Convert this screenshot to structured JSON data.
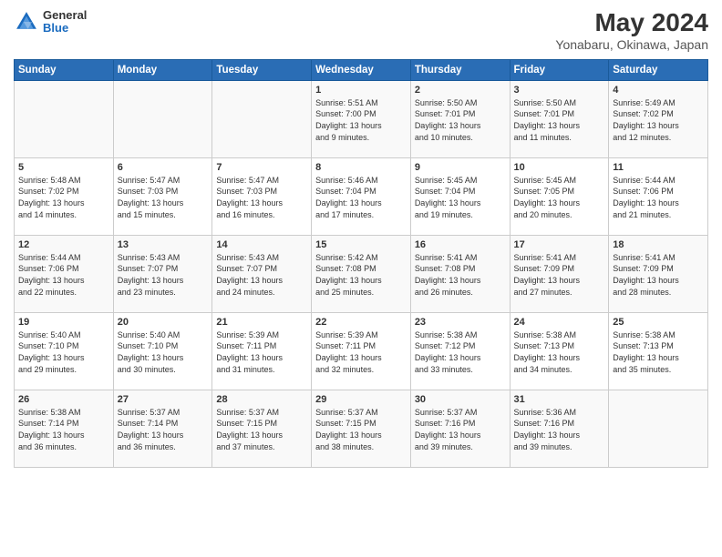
{
  "header": {
    "logo_general": "General",
    "logo_blue": "Blue",
    "title": "May 2024",
    "subtitle": "Yonabaru, Okinawa, Japan"
  },
  "days_of_week": [
    "Sunday",
    "Monday",
    "Tuesday",
    "Wednesday",
    "Thursday",
    "Friday",
    "Saturday"
  ],
  "weeks": [
    [
      {
        "day": "",
        "info": ""
      },
      {
        "day": "",
        "info": ""
      },
      {
        "day": "",
        "info": ""
      },
      {
        "day": "1",
        "info": "Sunrise: 5:51 AM\nSunset: 7:00 PM\nDaylight: 13 hours\nand 9 minutes."
      },
      {
        "day": "2",
        "info": "Sunrise: 5:50 AM\nSunset: 7:01 PM\nDaylight: 13 hours\nand 10 minutes."
      },
      {
        "day": "3",
        "info": "Sunrise: 5:50 AM\nSunset: 7:01 PM\nDaylight: 13 hours\nand 11 minutes."
      },
      {
        "day": "4",
        "info": "Sunrise: 5:49 AM\nSunset: 7:02 PM\nDaylight: 13 hours\nand 12 minutes."
      }
    ],
    [
      {
        "day": "5",
        "info": "Sunrise: 5:48 AM\nSunset: 7:02 PM\nDaylight: 13 hours\nand 14 minutes."
      },
      {
        "day": "6",
        "info": "Sunrise: 5:47 AM\nSunset: 7:03 PM\nDaylight: 13 hours\nand 15 minutes."
      },
      {
        "day": "7",
        "info": "Sunrise: 5:47 AM\nSunset: 7:03 PM\nDaylight: 13 hours\nand 16 minutes."
      },
      {
        "day": "8",
        "info": "Sunrise: 5:46 AM\nSunset: 7:04 PM\nDaylight: 13 hours\nand 17 minutes."
      },
      {
        "day": "9",
        "info": "Sunrise: 5:45 AM\nSunset: 7:04 PM\nDaylight: 13 hours\nand 19 minutes."
      },
      {
        "day": "10",
        "info": "Sunrise: 5:45 AM\nSunset: 7:05 PM\nDaylight: 13 hours\nand 20 minutes."
      },
      {
        "day": "11",
        "info": "Sunrise: 5:44 AM\nSunset: 7:06 PM\nDaylight: 13 hours\nand 21 minutes."
      }
    ],
    [
      {
        "day": "12",
        "info": "Sunrise: 5:44 AM\nSunset: 7:06 PM\nDaylight: 13 hours\nand 22 minutes."
      },
      {
        "day": "13",
        "info": "Sunrise: 5:43 AM\nSunset: 7:07 PM\nDaylight: 13 hours\nand 23 minutes."
      },
      {
        "day": "14",
        "info": "Sunrise: 5:43 AM\nSunset: 7:07 PM\nDaylight: 13 hours\nand 24 minutes."
      },
      {
        "day": "15",
        "info": "Sunrise: 5:42 AM\nSunset: 7:08 PM\nDaylight: 13 hours\nand 25 minutes."
      },
      {
        "day": "16",
        "info": "Sunrise: 5:41 AM\nSunset: 7:08 PM\nDaylight: 13 hours\nand 26 minutes."
      },
      {
        "day": "17",
        "info": "Sunrise: 5:41 AM\nSunset: 7:09 PM\nDaylight: 13 hours\nand 27 minutes."
      },
      {
        "day": "18",
        "info": "Sunrise: 5:41 AM\nSunset: 7:09 PM\nDaylight: 13 hours\nand 28 minutes."
      }
    ],
    [
      {
        "day": "19",
        "info": "Sunrise: 5:40 AM\nSunset: 7:10 PM\nDaylight: 13 hours\nand 29 minutes."
      },
      {
        "day": "20",
        "info": "Sunrise: 5:40 AM\nSunset: 7:10 PM\nDaylight: 13 hours\nand 30 minutes."
      },
      {
        "day": "21",
        "info": "Sunrise: 5:39 AM\nSunset: 7:11 PM\nDaylight: 13 hours\nand 31 minutes."
      },
      {
        "day": "22",
        "info": "Sunrise: 5:39 AM\nSunset: 7:11 PM\nDaylight: 13 hours\nand 32 minutes."
      },
      {
        "day": "23",
        "info": "Sunrise: 5:38 AM\nSunset: 7:12 PM\nDaylight: 13 hours\nand 33 minutes."
      },
      {
        "day": "24",
        "info": "Sunrise: 5:38 AM\nSunset: 7:13 PM\nDaylight: 13 hours\nand 34 minutes."
      },
      {
        "day": "25",
        "info": "Sunrise: 5:38 AM\nSunset: 7:13 PM\nDaylight: 13 hours\nand 35 minutes."
      }
    ],
    [
      {
        "day": "26",
        "info": "Sunrise: 5:38 AM\nSunset: 7:14 PM\nDaylight: 13 hours\nand 36 minutes."
      },
      {
        "day": "27",
        "info": "Sunrise: 5:37 AM\nSunset: 7:14 PM\nDaylight: 13 hours\nand 36 minutes."
      },
      {
        "day": "28",
        "info": "Sunrise: 5:37 AM\nSunset: 7:15 PM\nDaylight: 13 hours\nand 37 minutes."
      },
      {
        "day": "29",
        "info": "Sunrise: 5:37 AM\nSunset: 7:15 PM\nDaylight: 13 hours\nand 38 minutes."
      },
      {
        "day": "30",
        "info": "Sunrise: 5:37 AM\nSunset: 7:16 PM\nDaylight: 13 hours\nand 39 minutes."
      },
      {
        "day": "31",
        "info": "Sunrise: 5:36 AM\nSunset: 7:16 PM\nDaylight: 13 hours\nand 39 minutes."
      },
      {
        "day": "",
        "info": ""
      }
    ]
  ]
}
